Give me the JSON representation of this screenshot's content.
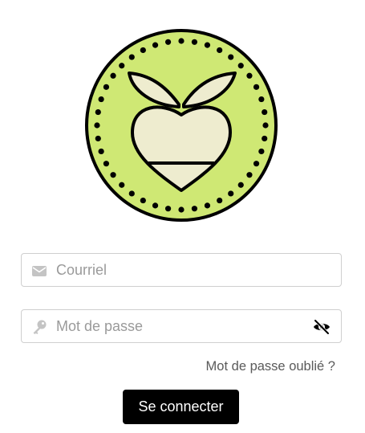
{
  "logo": {
    "icon": "turnip-badge-logo",
    "badge_color": "#cfe874",
    "bulb_color": "#eeeccf"
  },
  "email": {
    "icon": "envelope-icon",
    "placeholder": "Courriel",
    "value": ""
  },
  "password": {
    "icon": "key-icon",
    "placeholder": "Mot de passe",
    "value": "",
    "toggle_icon": "eye-slash-icon"
  },
  "forgot_password_link": "Mot de passe oublié ?",
  "submit_label": "Se connecter",
  "colors": {
    "button_bg": "#000000",
    "button_text": "#ffffff",
    "border": "#cfcfcf",
    "placeholder": "#9a9a9a",
    "link": "#5a5a5a"
  }
}
